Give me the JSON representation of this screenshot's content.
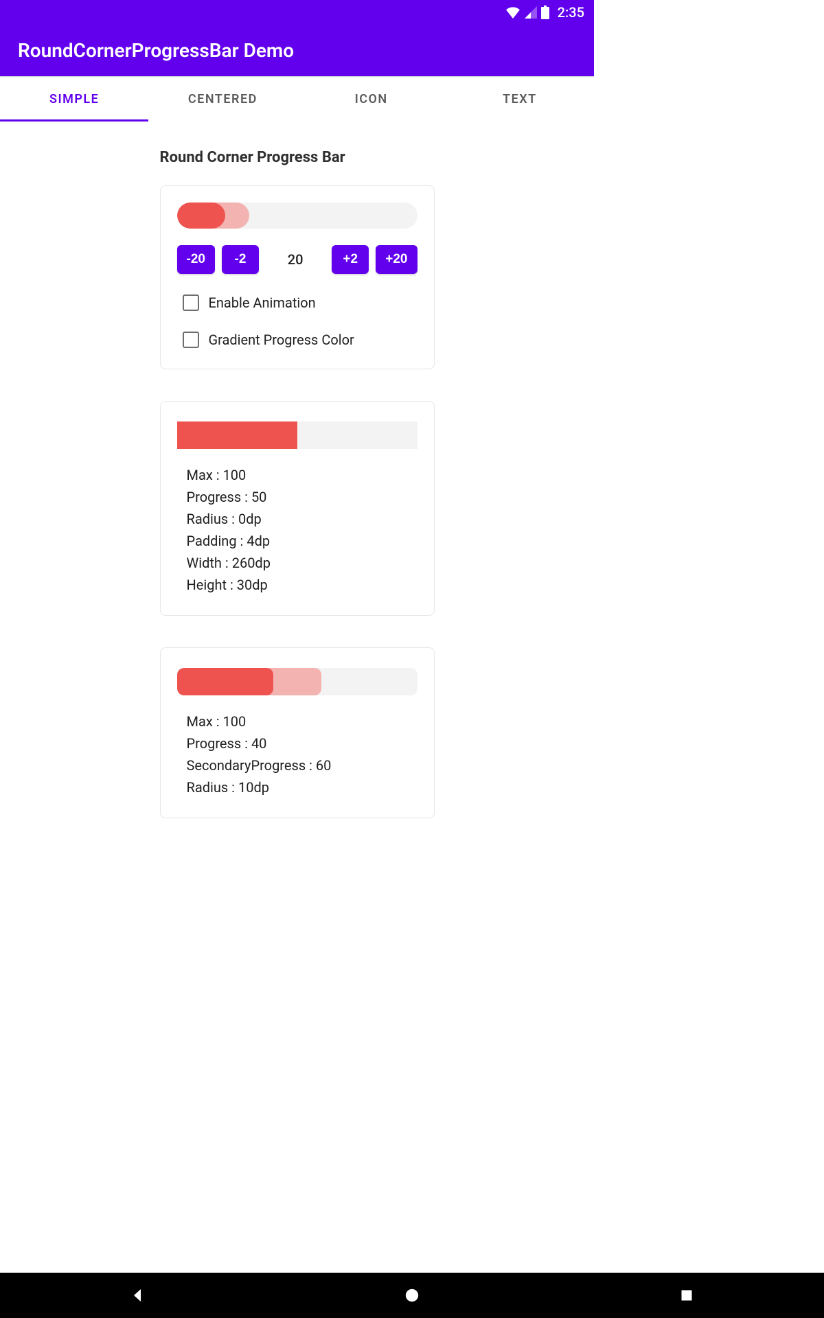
{
  "statusbar": {
    "time": "2:35"
  },
  "appbar": {
    "title": "RoundCornerProgressBar Demo"
  },
  "tabs": [
    {
      "label": "SIMPLE",
      "active": true
    },
    {
      "label": "CENTERED",
      "active": false
    },
    {
      "label": "ICON",
      "active": false
    },
    {
      "label": "TEXT",
      "active": false
    }
  ],
  "section_title": "Round Corner Progress Bar",
  "card1": {
    "progress_percent": 20,
    "secondary_percent": 30,
    "buttons": {
      "dec20": "-20",
      "dec2": "-2",
      "inc2": "+2",
      "inc20": "+20"
    },
    "value_text": "20",
    "check_anim": "Enable Animation",
    "check_gradient": "Gradient Progress Color"
  },
  "card2": {
    "progress_percent": 50,
    "rows": [
      "Max : 100",
      "Progress : 50",
      "Radius : 0dp",
      "Padding : 4dp",
      "Width : 260dp",
      "Height : 30dp"
    ]
  },
  "card3": {
    "progress_percent": 40,
    "secondary_percent": 60,
    "rows": [
      "Max : 100",
      "Progress : 40",
      "SecondaryProgress : 60",
      "Radius : 10dp"
    ]
  },
  "colors": {
    "primary": "#6200EE",
    "progress": "#ef5350",
    "progress_secondary": "#f3b3b0",
    "track": "#f3f3f3"
  }
}
